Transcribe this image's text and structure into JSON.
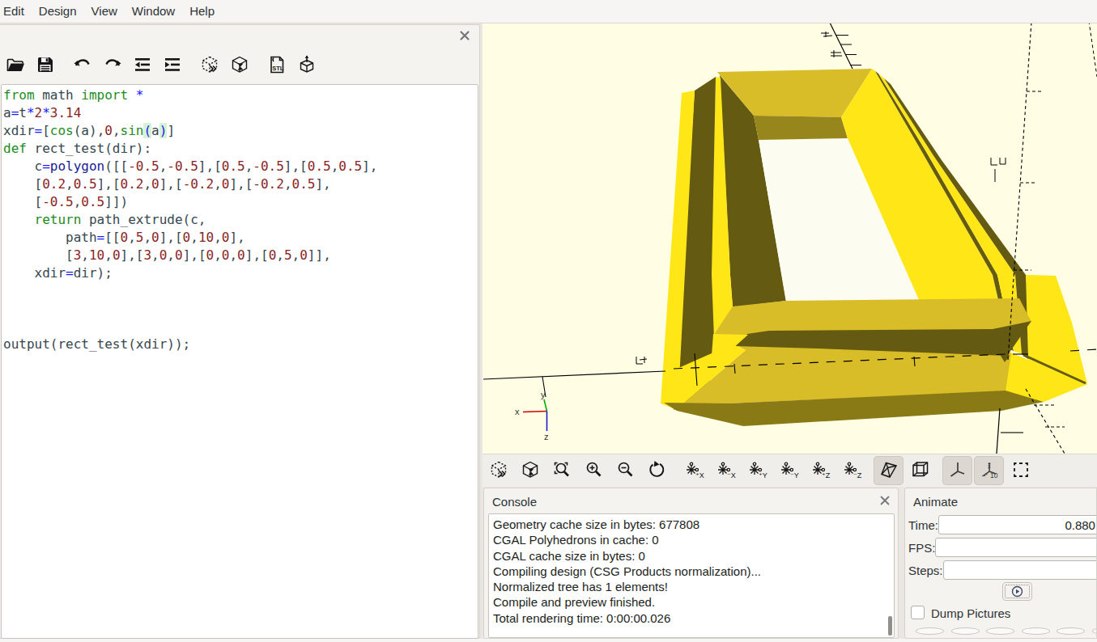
{
  "menu": {
    "items": [
      "Edit",
      "Design",
      "View",
      "Window",
      "Help"
    ]
  },
  "editor": {
    "toolbar_icons": [
      "open",
      "save",
      "undo",
      "redo",
      "unindent",
      "indent",
      "preview",
      "render",
      "export-stl",
      "export-3d"
    ],
    "close_icon": "close",
    "syntax_colors": {
      "keyword": "#1e8c1e",
      "identifier": "#37474f",
      "number": "#8b1f1f",
      "operator": "#1b1bff",
      "builtin": "#1a1a96",
      "bracket_match_bg": "#d8f3d3"
    },
    "lines": [
      [
        [
          "from",
          "kw"
        ],
        [
          " math ",
          "id"
        ],
        [
          "import",
          "kw"
        ],
        [
          " ",
          "id"
        ],
        [
          "*",
          "op"
        ]
      ],
      [
        [
          "a",
          "id"
        ],
        [
          "=",
          "op"
        ],
        [
          "t",
          "id"
        ],
        [
          "*",
          "op"
        ],
        [
          "2",
          "num"
        ],
        [
          "*",
          "op"
        ],
        [
          "3.14",
          "num"
        ]
      ],
      [
        [
          "xdir",
          "id"
        ],
        [
          "=",
          "op"
        ],
        [
          "[",
          "id"
        ],
        [
          "cos",
          "kw"
        ],
        [
          "(a)",
          "id"
        ],
        [
          ",",
          "id"
        ],
        [
          "0",
          "num"
        ],
        [
          ",",
          "id"
        ],
        [
          "sin",
          "kw"
        ],
        [
          "(",
          "m"
        ],
        [
          "a",
          "id"
        ],
        [
          ")",
          "m"
        ],
        [
          "]",
          "id"
        ]
      ],
      [
        [
          "def",
          "kw"
        ],
        [
          " rect_test(dir):",
          "id"
        ]
      ],
      [
        [
          "    c",
          "id"
        ],
        [
          "=",
          "op"
        ],
        [
          "polygon",
          "fn"
        ],
        [
          "([[",
          "id"
        ],
        [
          "-0.5",
          "num"
        ],
        [
          ",",
          "id"
        ],
        [
          "-0.5",
          "num"
        ],
        [
          "],[",
          "id"
        ],
        [
          "0.5",
          "num"
        ],
        [
          ",",
          "id"
        ],
        [
          "-0.5",
          "num"
        ],
        [
          "],[",
          "id"
        ],
        [
          "0.5",
          "num"
        ],
        [
          ",",
          "id"
        ],
        [
          "0.5",
          "num"
        ],
        [
          "],",
          "id"
        ]
      ],
      [
        [
          "    [",
          "id"
        ],
        [
          "0.2",
          "num"
        ],
        [
          ",",
          "id"
        ],
        [
          "0.5",
          "num"
        ],
        [
          "],[",
          "id"
        ],
        [
          "0.2",
          "num"
        ],
        [
          ",",
          "id"
        ],
        [
          "0",
          "num"
        ],
        [
          "],[",
          "id"
        ],
        [
          "-0.2",
          "num"
        ],
        [
          ",",
          "id"
        ],
        [
          "0",
          "num"
        ],
        [
          "],[",
          "id"
        ],
        [
          "-0.2",
          "num"
        ],
        [
          ",",
          "id"
        ],
        [
          "0.5",
          "num"
        ],
        [
          "],",
          "id"
        ]
      ],
      [
        [
          "    [",
          "id"
        ],
        [
          "-0.5",
          "num"
        ],
        [
          ",",
          "id"
        ],
        [
          "0.5",
          "num"
        ],
        [
          "]])",
          "id"
        ]
      ],
      [
        [
          "    ",
          "id"
        ],
        [
          "return",
          "kw"
        ],
        [
          " path_extrude(c,",
          "id"
        ]
      ],
      [
        [
          "        path",
          "id"
        ],
        [
          "=",
          "op"
        ],
        [
          "[[",
          "id"
        ],
        [
          "0",
          "num"
        ],
        [
          ",",
          "id"
        ],
        [
          "5",
          "num"
        ],
        [
          ",",
          "id"
        ],
        [
          "0",
          "num"
        ],
        [
          "],[",
          "id"
        ],
        [
          "0",
          "num"
        ],
        [
          ",",
          "id"
        ],
        [
          "10",
          "num"
        ],
        [
          ",",
          "id"
        ],
        [
          "0",
          "num"
        ],
        [
          "],",
          "id"
        ]
      ],
      [
        [
          "        [",
          "id"
        ],
        [
          "3",
          "num"
        ],
        [
          ",",
          "id"
        ],
        [
          "10",
          "num"
        ],
        [
          ",",
          "id"
        ],
        [
          "0",
          "num"
        ],
        [
          "],[",
          "id"
        ],
        [
          "3",
          "num"
        ],
        [
          ",",
          "id"
        ],
        [
          "0",
          "num"
        ],
        [
          ",",
          "id"
        ],
        [
          "0",
          "num"
        ],
        [
          "],[",
          "id"
        ],
        [
          "0",
          "num"
        ],
        [
          ",",
          "id"
        ],
        [
          "0",
          "num"
        ],
        [
          ",",
          "id"
        ],
        [
          "0",
          "num"
        ],
        [
          "],[",
          "id"
        ],
        [
          "0",
          "num"
        ],
        [
          ",",
          "id"
        ],
        [
          "5",
          "num"
        ],
        [
          ",",
          "id"
        ],
        [
          "0",
          "num"
        ],
        [
          "]],",
          "id"
        ]
      ],
      [
        [
          "    xdir",
          "id"
        ],
        [
          "=",
          "op"
        ],
        [
          "dir);",
          "id"
        ]
      ],
      [],
      [],
      [],
      [
        [
          "output(rect_test(xdir));",
          "id"
        ]
      ]
    ]
  },
  "viewport": {
    "background": "#fffee5",
    "object_bright": "#ffe616",
    "object_medium": "#d8bc28",
    "object_dark": "#645a11",
    "object_under": "#8a7a16",
    "axis_indicator": {
      "x": "x",
      "y": "y",
      "z": "z",
      "x_color": "#cc0000",
      "y_color": "#00aa00",
      "z_color": "#1a1acc"
    }
  },
  "viewport_toolbar": {
    "icons": [
      {
        "name": "preview",
        "pressed": false
      },
      {
        "name": "render",
        "pressed": false
      },
      {
        "name": "zoom-all",
        "pressed": false
      },
      {
        "name": "zoom-in",
        "pressed": false
      },
      {
        "name": "zoom-out",
        "pressed": false
      },
      {
        "name": "reset-view",
        "pressed": false
      },
      {
        "name": "view-plus-x",
        "pressed": false,
        "label": "+X"
      },
      {
        "name": "view-minus-x",
        "pressed": false,
        "label": "-X"
      },
      {
        "name": "view-plus-y",
        "pressed": false,
        "label": "+Y"
      },
      {
        "name": "view-minus-y",
        "pressed": false,
        "label": "-Y"
      },
      {
        "name": "view-plus-z",
        "pressed": false,
        "label": "+Z"
      },
      {
        "name": "view-minus-z",
        "pressed": false,
        "label": "-Z"
      },
      {
        "name": "perspective",
        "pressed": true
      },
      {
        "name": "orthographic",
        "pressed": false
      },
      {
        "name": "show-axes",
        "pressed": true
      },
      {
        "name": "show-scale-markers",
        "pressed": true,
        "label": "10"
      },
      {
        "name": "view-all",
        "pressed": false
      }
    ]
  },
  "console": {
    "title": "Console",
    "close_icon": "close",
    "lines": [
      "Geometry cache size in bytes: 677808",
      "CGAL Polyhedrons in cache: 0",
      "CGAL cache size in bytes: 0",
      "Compiling design (CSG Products normalization)...",
      "Normalized tree has 1 elements!",
      "Compile and preview finished.",
      "Total rendering time: 0:00:00.026"
    ]
  },
  "animate": {
    "title": "Animate",
    "fields": [
      {
        "label": "Time:",
        "value": "0.880"
      },
      {
        "label": "FPS:",
        "value": ""
      },
      {
        "label": "Steps:",
        "value": ""
      }
    ],
    "play_icon": "play",
    "dump_label": "Dump Pictures"
  }
}
